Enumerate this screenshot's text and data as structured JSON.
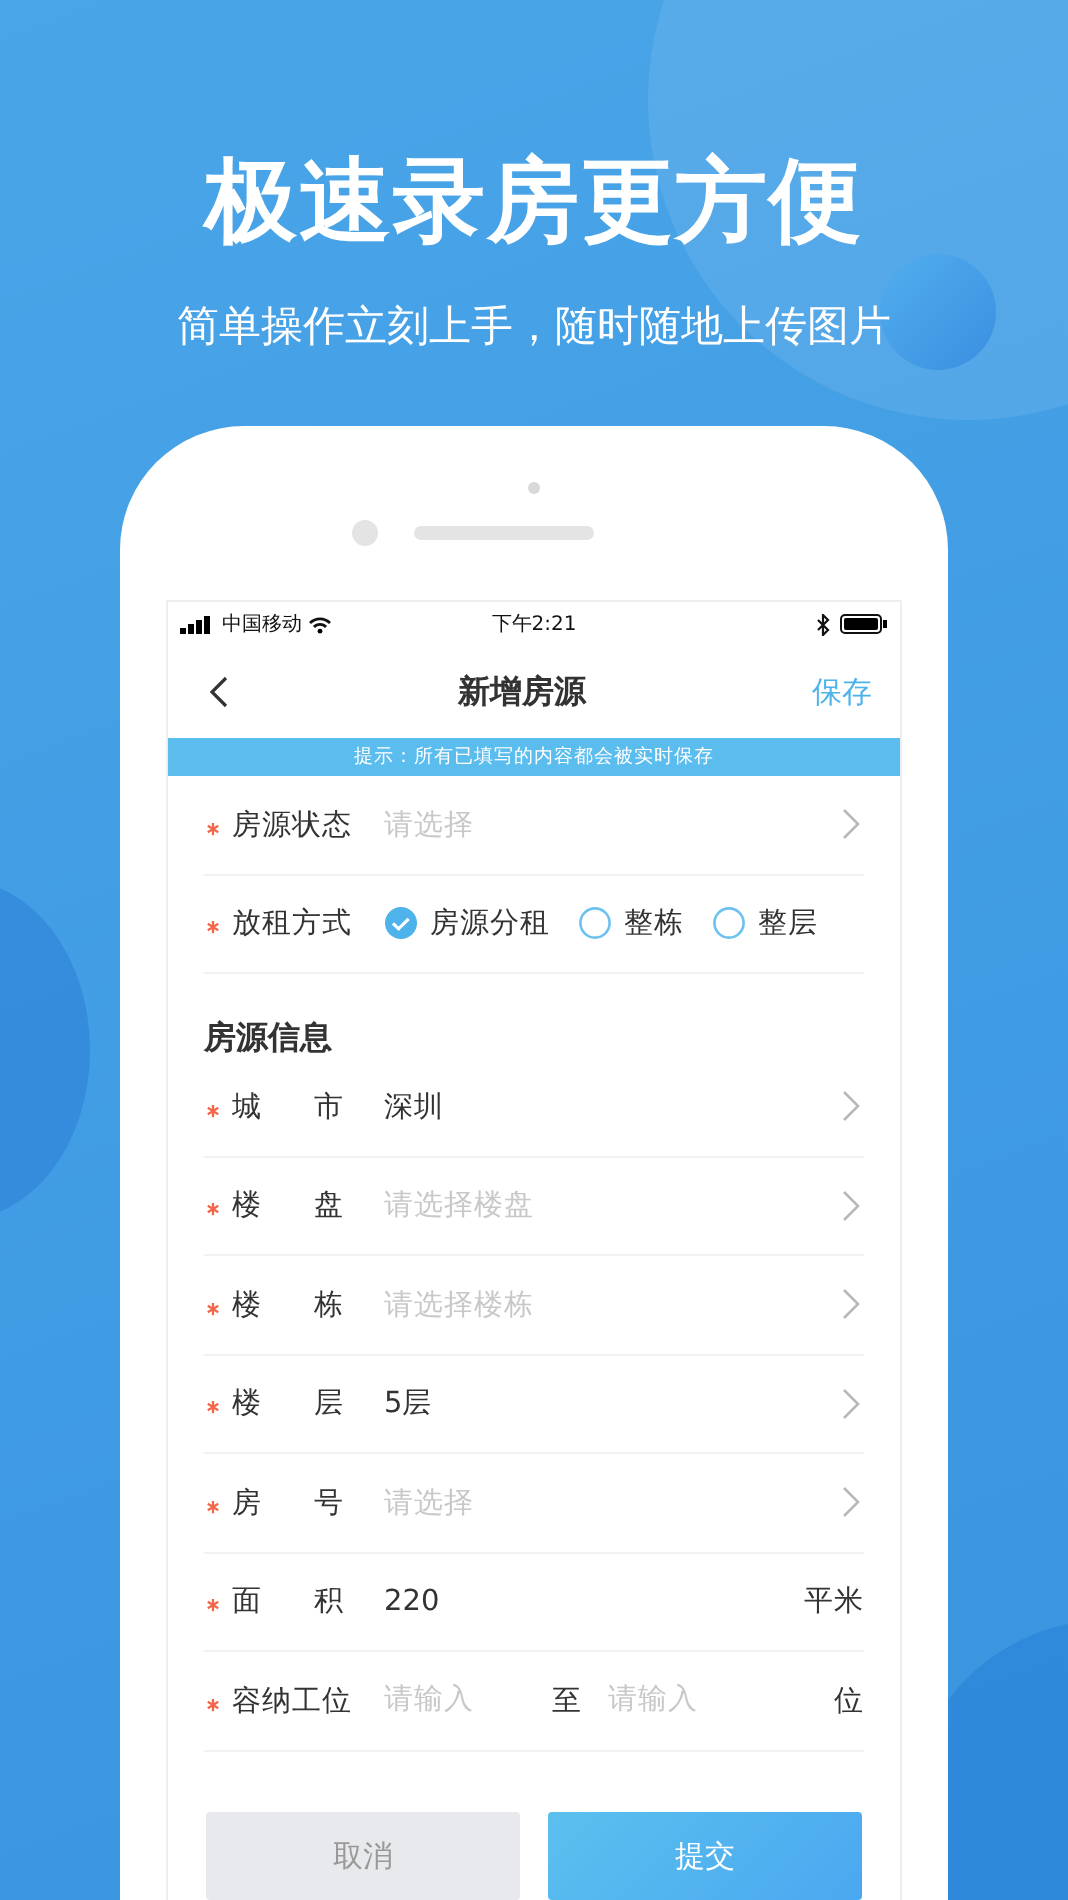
{
  "hero": {
    "title": "极速录房更方便",
    "subtitle": "简单操作立刻上手，随时随地上传图片"
  },
  "status_bar": {
    "carrier": "中国移动",
    "time": "下午2:21"
  },
  "nav": {
    "title": "新增房源",
    "action": "保存"
  },
  "notice": "提示：所有已填写的内容都会被实时保存",
  "top_fields": [
    {
      "kind": "select",
      "required": true,
      "label": "房源状态",
      "placeholder": "请选择"
    },
    {
      "kind": "radio",
      "required": true,
      "label": "放租方式",
      "options": [
        {
          "label": "房源分租",
          "selected": true
        },
        {
          "label": "整栋",
          "selected": false
        },
        {
          "label": "整层",
          "selected": false
        }
      ]
    }
  ],
  "section_title": "房源信息",
  "fields": [
    {
      "kind": "select",
      "required": true,
      "label": "城市",
      "value": "深圳"
    },
    {
      "kind": "select",
      "required": true,
      "label": "楼盘",
      "placeholder": "请选择楼盘"
    },
    {
      "kind": "select",
      "required": true,
      "label": "楼栋",
      "placeholder": "请选择楼栋"
    },
    {
      "kind": "select",
      "required": true,
      "label": "楼层",
      "value": "5层"
    },
    {
      "kind": "select",
      "required": true,
      "label": "房号",
      "placeholder": "请选择"
    },
    {
      "kind": "unit",
      "required": true,
      "label": "面积",
      "value": "220",
      "unit": "平米"
    },
    {
      "kind": "range",
      "required": true,
      "label": "容纳工位",
      "placeholder": "请输入",
      "separator": "至",
      "placeholder_to": "请输入",
      "unit": "位"
    }
  ],
  "buttons": [
    {
      "label": "取消",
      "kind": "cancel"
    },
    {
      "label": "提交",
      "kind": "primary"
    }
  ]
}
